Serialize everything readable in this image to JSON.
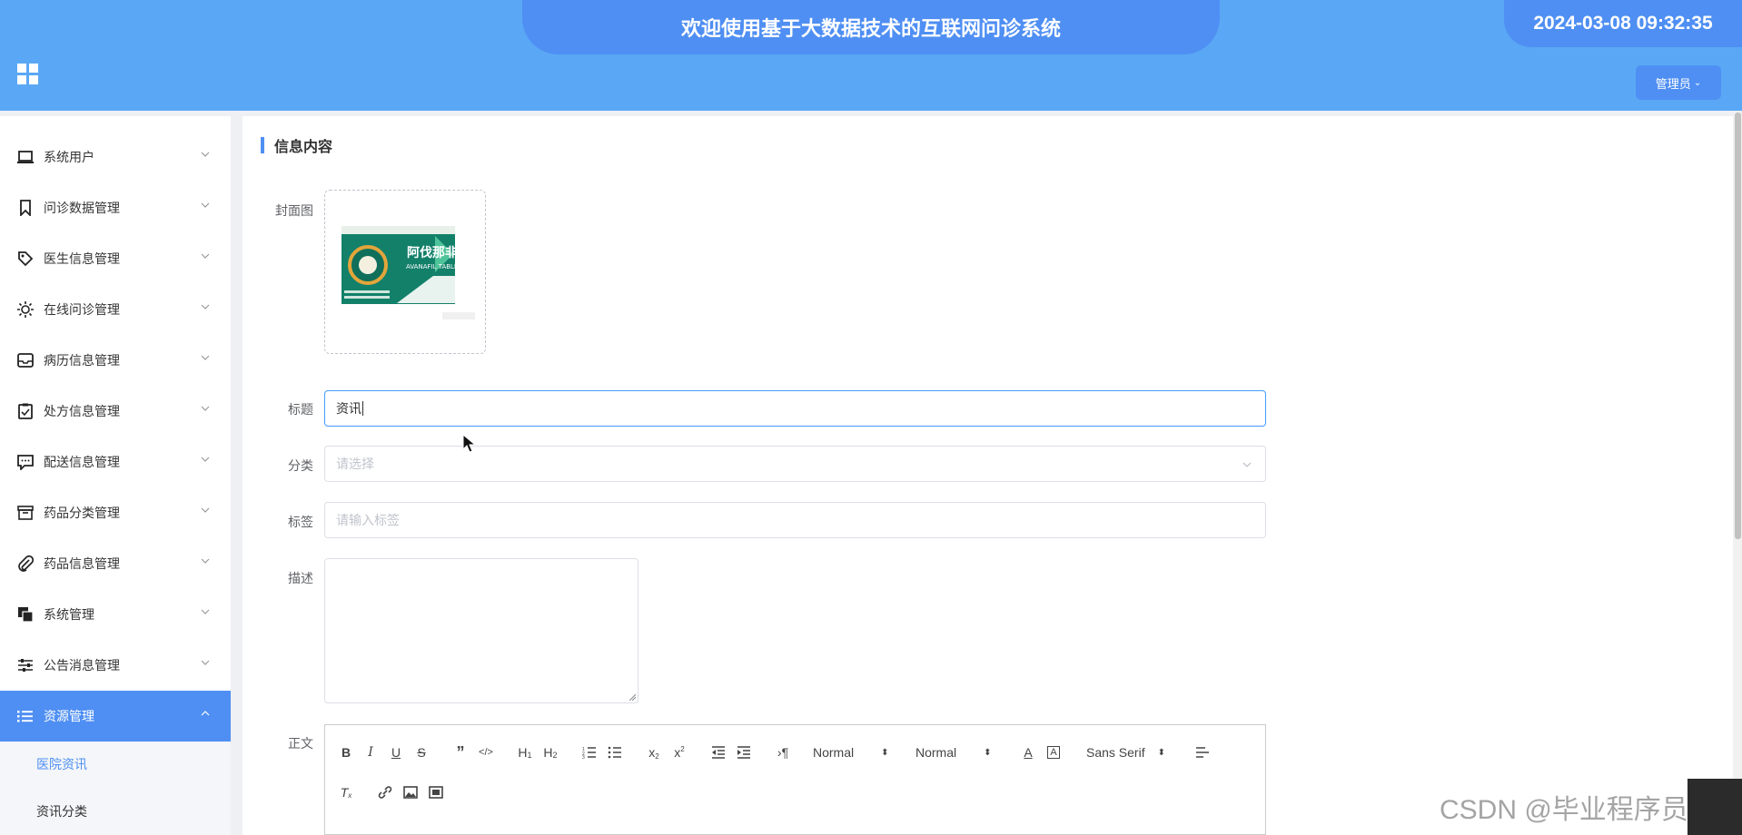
{
  "header": {
    "title": "欢迎使用基于大数据技术的互联网问诊系统",
    "datetime": "2024-03-08 09:32:35",
    "user_menu": "管理员"
  },
  "sidebar": {
    "items": [
      {
        "label": "系统用户",
        "icon": "laptop-icon"
      },
      {
        "label": "问诊数据管理",
        "icon": "bookmark-icon"
      },
      {
        "label": "医生信息管理",
        "icon": "tag-icon"
      },
      {
        "label": "在线问诊管理",
        "icon": "sun-icon"
      },
      {
        "label": "病历信息管理",
        "icon": "inbox-icon"
      },
      {
        "label": "处方信息管理",
        "icon": "clipboard-icon"
      },
      {
        "label": "配送信息管理",
        "icon": "chat-icon"
      },
      {
        "label": "药品分类管理",
        "icon": "archive-icon"
      },
      {
        "label": "药品信息管理",
        "icon": "paperclip-icon"
      },
      {
        "label": "系统管理",
        "icon": "copy-icon"
      },
      {
        "label": "公告消息管理",
        "icon": "sliders-icon"
      },
      {
        "label": "资源管理",
        "icon": "list-icon"
      }
    ],
    "sub_items": [
      {
        "label": "医院资讯"
      },
      {
        "label": "资讯分类"
      }
    ]
  },
  "form": {
    "section_title": "信息内容",
    "cover_label": "封面图",
    "title_label": "标题",
    "title_value": "资讯",
    "category_label": "分类",
    "category_placeholder": "请选择",
    "tags_label": "标签",
    "tags_placeholder": "请输入标签",
    "desc_label": "描述",
    "body_label": "正文"
  },
  "thumbnail": {
    "drug_name": "阿伐那非片",
    "drug_name_en": "AVANAFIL TABLETS"
  },
  "editor_toolbar": {
    "header_select": "Normal",
    "size_select": "Normal",
    "font_select": "Sans Serif"
  },
  "watermark": "CSDN @毕业程序员",
  "colors": {
    "header_bg": "#5aa8f5",
    "accent": "#4f8ff3",
    "focus_border": "#409eff"
  }
}
